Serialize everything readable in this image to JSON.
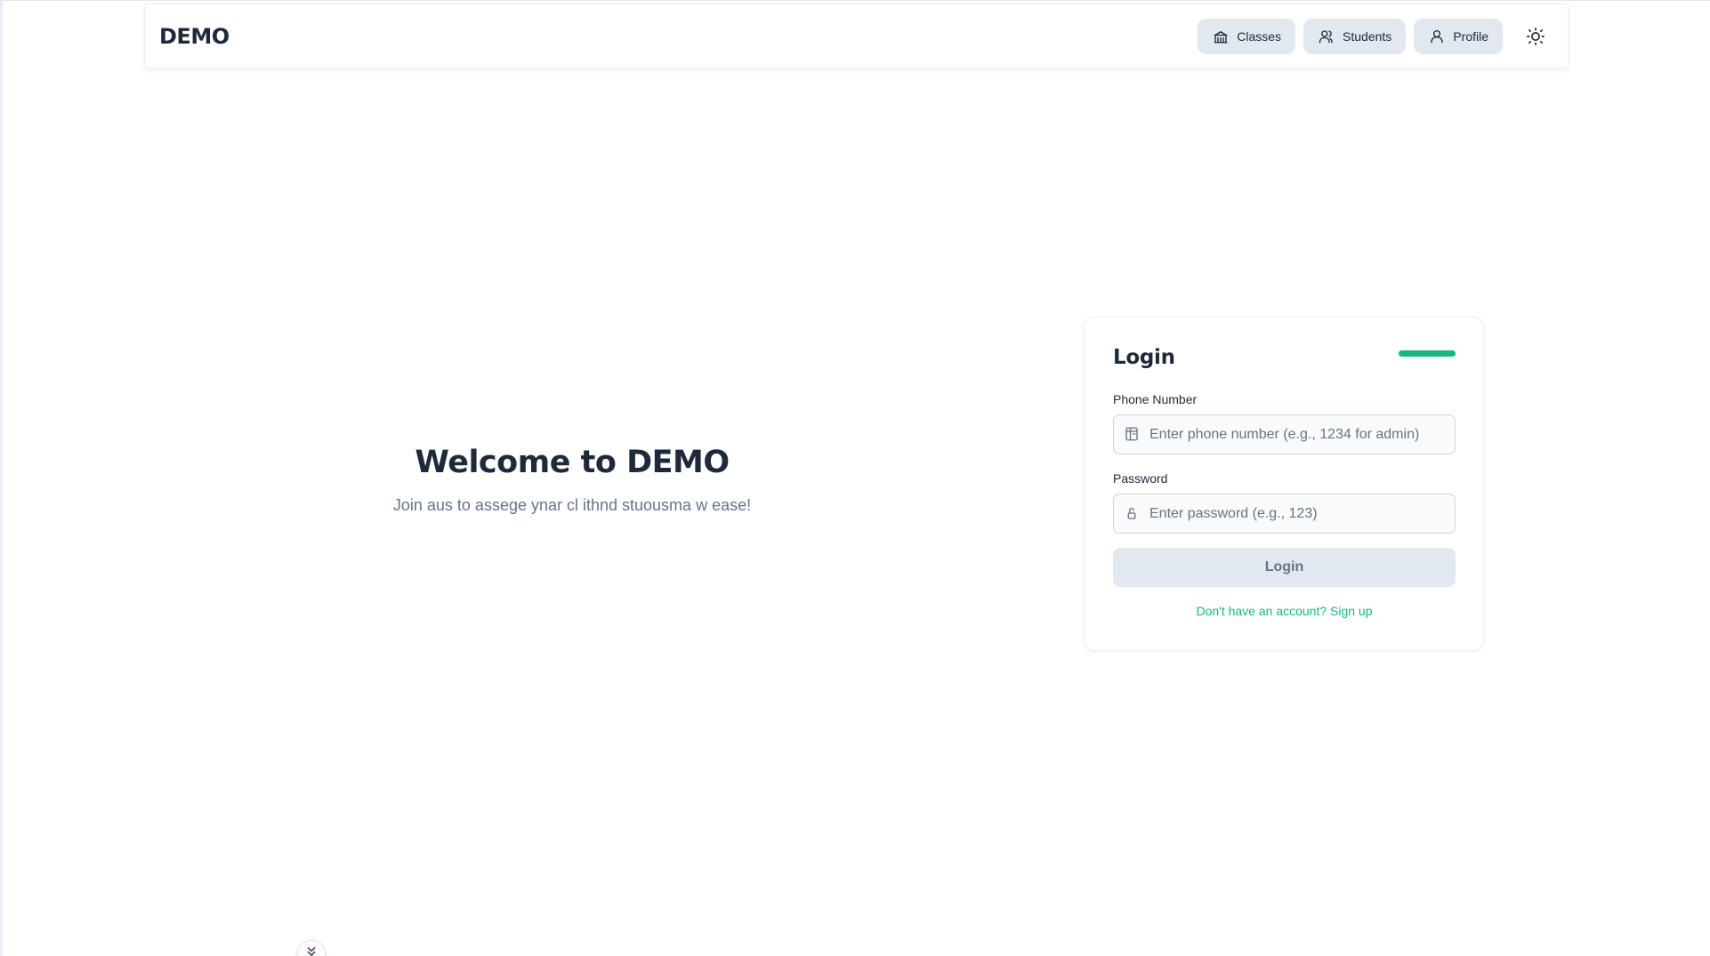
{
  "header": {
    "brand": "DEMO",
    "nav": [
      {
        "label": "Classes",
        "icon": "school-icon"
      },
      {
        "label": "Students",
        "icon": "users-icon"
      },
      {
        "label": "Profile",
        "icon": "user-icon"
      }
    ],
    "theme_toggle_icon": "sun-icon"
  },
  "hero": {
    "title": "Welcome to DEMO",
    "subtitle": "Join aus to assege ynar cl ithnd stuousma w ease!"
  },
  "login": {
    "title": "Login",
    "accent_color": "#10b981",
    "phone": {
      "label": "Phone Number",
      "placeholder": "Enter phone number (e.g., 1234 for admin)",
      "value": "",
      "icon": "phone-card-icon"
    },
    "password": {
      "label": "Password",
      "placeholder": "Enter password (e.g., 123)",
      "value": "",
      "icon": "lock-icon"
    },
    "submit_label": "Login",
    "signup_text": "Don't have an account? Sign up"
  },
  "floating_control_icon": "chevron-icon"
}
